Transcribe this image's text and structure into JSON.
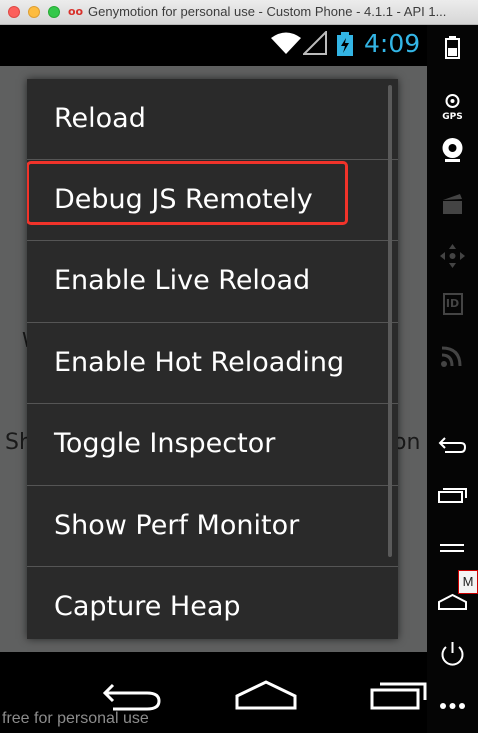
{
  "window": {
    "title": "Genymotion for personal use - Custom Phone - 4.1.1 - API 1..."
  },
  "statusbar": {
    "time": "4:09"
  },
  "background": {
    "left_text": "Sh",
    "right_text": "on",
    "w_text": "W"
  },
  "menu": {
    "items": [
      {
        "label": "Reload"
      },
      {
        "label": "Debug JS Remotely"
      },
      {
        "label": "Enable Live Reload"
      },
      {
        "label": "Enable Hot Reloading"
      },
      {
        "label": "Toggle Inspector"
      },
      {
        "label": "Show Perf Monitor"
      },
      {
        "label": "Capture Heap"
      }
    ],
    "highlighted_index": 1,
    "highlight_color": "#f1332a"
  },
  "footer": {
    "watermark": "free for personal use"
  },
  "sidebar": {
    "gps_label": "GPS",
    "id_label": "ID",
    "m_badge": "M",
    "icons": [
      "battery-icon",
      "gps-icon",
      "webcam-icon",
      "clapper-icon",
      "move-icon",
      "id-icon",
      "rss-icon",
      "back-icon",
      "recent-apps-icon",
      "menu-icon",
      "home-icon",
      "power-icon",
      "more-icon"
    ]
  },
  "colors": {
    "clock": "#33b5e5",
    "menu_bg": "#2a2a2a",
    "app_bg": "#5f6060"
  }
}
